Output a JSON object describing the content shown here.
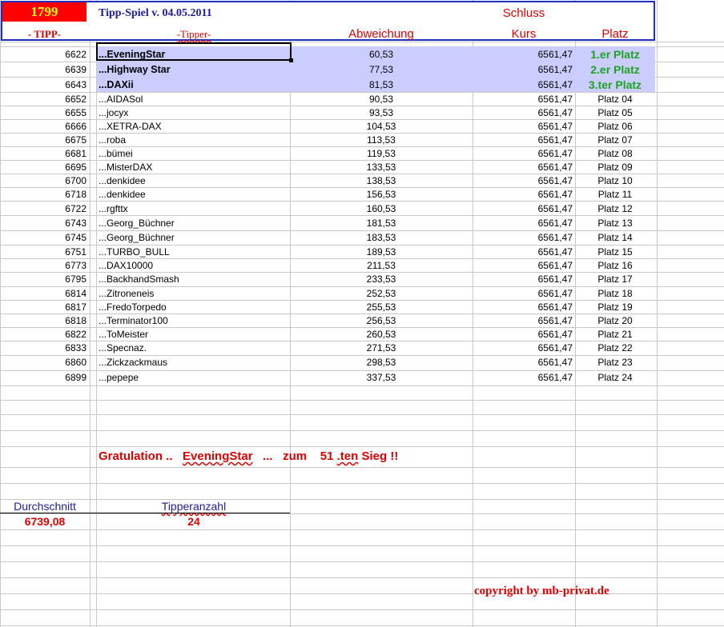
{
  "header": {
    "number": "1799",
    "title": "Tipp-Spiel v. 04.05.2011",
    "schluss": "Schluss",
    "col_tipp": "- TIPP-",
    "col_tipper": "-Tipper-",
    "col_abweichung": "Abweichung",
    "col_kurs": "Kurs",
    "col_platz": "Platz"
  },
  "rows": [
    {
      "tipp": "6622",
      "name": "...EveningStar",
      "abw": "60,53",
      "kurs": "6561,47",
      "platz": "1.er Platz"
    },
    {
      "tipp": "6639",
      "name": "...Highway Star",
      "abw": "77,53",
      "kurs": "6561,47",
      "platz": "2.er Platz"
    },
    {
      "tipp": "6643",
      "name": "...DAXii",
      "abw": "81,53",
      "kurs": "6561,47",
      "platz": "3.ter Platz"
    },
    {
      "tipp": "6652",
      "name": "...AIDASol",
      "abw": "90,53",
      "kurs": "6561,47",
      "platz": "Platz 04"
    },
    {
      "tipp": "6655",
      "name": "...jocyx",
      "abw": "93,53",
      "kurs": "6561,47",
      "platz": "Platz 05"
    },
    {
      "tipp": "6666",
      "name": "...XETRA-DAX",
      "abw": "104,53",
      "kurs": "6561,47",
      "platz": "Platz 06"
    },
    {
      "tipp": "6675",
      "name": "...roba",
      "abw": "113,53",
      "kurs": "6561,47",
      "platz": "Platz 07"
    },
    {
      "tipp": "6681",
      "name": "...bümei",
      "abw": "119,53",
      "kurs": "6561,47",
      "platz": "Platz 08"
    },
    {
      "tipp": "6695",
      "name": "...MisterDAX",
      "abw": "133,53",
      "kurs": "6561,47",
      "platz": "Platz 09"
    },
    {
      "tipp": "6700",
      "name": "...denkidee",
      "abw": "138,53",
      "kurs": "6561,47",
      "platz": "Platz 10"
    },
    {
      "tipp": "6718",
      "name": "...denkidee",
      "abw": "156,53",
      "kurs": "6561,47",
      "platz": "Platz 11"
    },
    {
      "tipp": "6722",
      "name": "...rgfttx",
      "abw": "160,53",
      "kurs": "6561,47",
      "platz": "Platz 12"
    },
    {
      "tipp": "6743",
      "name": "...Georg_Büchner",
      "abw": "181,53",
      "kurs": "6561,47",
      "platz": "Platz 13"
    },
    {
      "tipp": "6745",
      "name": "...Georg_Büchner",
      "abw": "183,53",
      "kurs": "6561,47",
      "platz": "Platz 14"
    },
    {
      "tipp": "6751",
      "name": "...TURBO_BULL",
      "abw": "189,53",
      "kurs": "6561,47",
      "platz": "Platz 15"
    },
    {
      "tipp": "6773",
      "name": "...DAX10000",
      "abw": "211,53",
      "kurs": "6561,47",
      "platz": "Platz 16"
    },
    {
      "tipp": "6795",
      "name": "...BackhandSmash",
      "abw": "233,53",
      "kurs": "6561,47",
      "platz": "Platz 17"
    },
    {
      "tipp": "6814",
      "name": "...Zitroneneis",
      "abw": "252,53",
      "kurs": "6561,47",
      "platz": "Platz 18"
    },
    {
      "tipp": "6817",
      "name": "...FredoTorpedo",
      "abw": "255,53",
      "kurs": "6561,47",
      "platz": "Platz 19"
    },
    {
      "tipp": "6818",
      "name": "...Terminator100",
      "abw": "256,53",
      "kurs": "6561,47",
      "platz": "Platz 20"
    },
    {
      "tipp": "6822",
      "name": "...ToMeister",
      "abw": "260,53",
      "kurs": "6561,47",
      "platz": "Platz 21"
    },
    {
      "tipp": "6833",
      "name": "...Specnaz.",
      "abw": "271,53",
      "kurs": "6561,47",
      "platz": "Platz 22"
    },
    {
      "tipp": "6860",
      "name": "...Zickzackmaus",
      "abw": "298,53",
      "kurs": "6561,47",
      "platz": "Platz 23"
    },
    {
      "tipp": "6899",
      "name": "...pepepe",
      "abw": "337,53",
      "kurs": "6561,47",
      "platz": "Platz 24"
    }
  ],
  "gratulation": {
    "prefix": "Gratulation ..",
    "winner": "EveningStar",
    "dots": "...",
    "zum": "zum",
    "count": "51",
    "suffix_ten": ".ten",
    "sieg": "Sieg !!"
  },
  "stats": {
    "durchschnitt_label": "Durchschnitt",
    "durchschnitt_value": "6739,08",
    "tipperanzahl_label": "Tipperanzahl",
    "tipperanzahl_value": "24"
  },
  "copyright": "copyright by mb-privat.de",
  "colors": {
    "red": "#e00000",
    "green": "#1aa51a",
    "highlight": "#cccdff",
    "blue_border": "#1f2fc0"
  }
}
